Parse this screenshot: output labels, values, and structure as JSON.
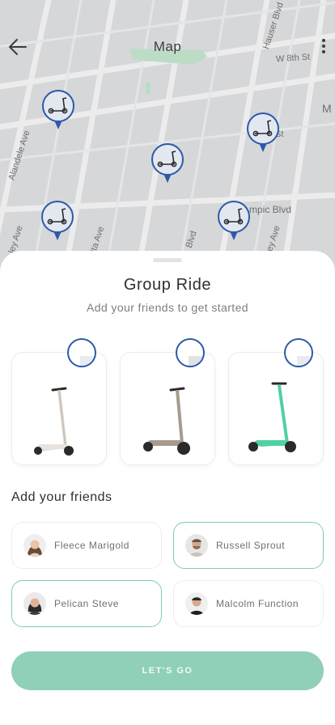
{
  "map": {
    "title": "Map",
    "street_labels": {
      "hauser": "Hauser Blvd",
      "w8th": "W 8th St",
      "st": "St",
      "olympic": "mpic Blvd",
      "alandele": "Alandele Ave",
      "blvd": "Blvd",
      "ita": "ita Ave",
      "ley1": "ley Ave",
      "ley2": "ley Ave",
      "m": "M"
    },
    "back_icon": "arrow-left-icon",
    "menu_icon": "more-vertical-icon",
    "pin_icon": "scooter-pin-icon"
  },
  "sheet": {
    "title": "Group Ride",
    "subtitle": "Add your friends to get started",
    "section_title": "Add your friends",
    "cta": "LET'S GO"
  },
  "scooters": [
    {
      "color": "#e8e4dd",
      "avatar": "woman-dark-hair"
    },
    {
      "color": "#a89b8e",
      "avatar": "man-short-hair"
    },
    {
      "color": "#4fd1a0",
      "avatar": "woman-blonde"
    }
  ],
  "friends": [
    {
      "name": "Fleece Marigold",
      "selected": false
    },
    {
      "name": "Russell Sprout",
      "selected": true
    },
    {
      "name": "Pelican Steve",
      "selected": true
    },
    {
      "name": "Malcolm Function",
      "selected": false
    }
  ],
  "colors": {
    "accent": "#8fd0b7",
    "selected_border": "#7fcdb1",
    "pin": "#2b5aa8"
  }
}
